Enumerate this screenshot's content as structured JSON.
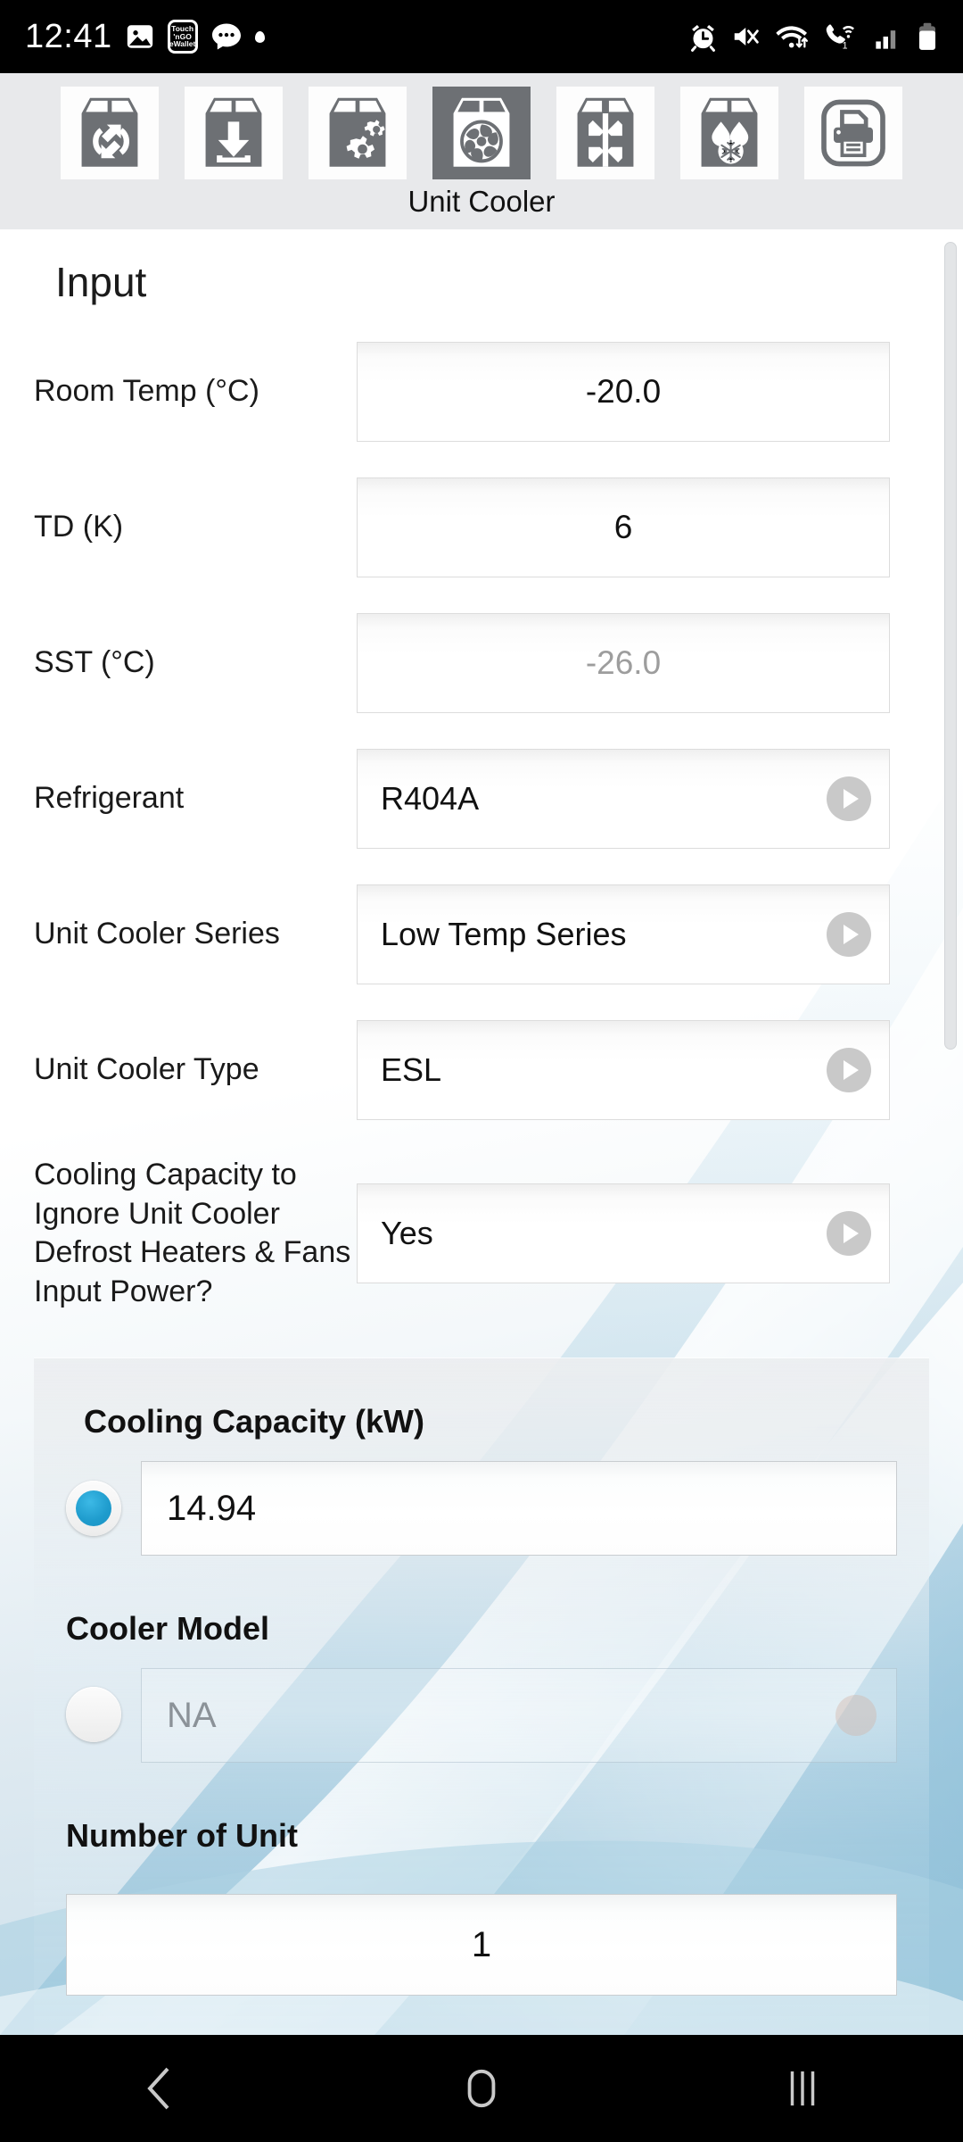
{
  "status_bar": {
    "time": "12:41",
    "left_icons": [
      "photo-icon",
      "touch-n-go-wallet-icon",
      "messages-icon",
      "notification-dot-icon"
    ],
    "tng_line1": "Touch",
    "tng_line2": "'nGO",
    "tng_line3": "eWallet",
    "right_icons": [
      "alarm-icon",
      "mute-vibrate-icon",
      "wifi-data-icon",
      "wifi-calling-icon",
      "signal-bars-icon",
      "battery-icon"
    ],
    "wifi_calling_badge": "1"
  },
  "toolbar": {
    "title": "Unit Cooler",
    "buttons": [
      {
        "name": "box-refresh",
        "selected": false
      },
      {
        "name": "box-download",
        "selected": false
      },
      {
        "name": "box-gears",
        "selected": false
      },
      {
        "name": "box-fan",
        "selected": true
      },
      {
        "name": "box-compress",
        "selected": false
      },
      {
        "name": "box-defrost-droplets",
        "selected": false
      },
      {
        "name": "printer",
        "selected": false
      }
    ]
  },
  "input_section": {
    "title": "Input",
    "fields": [
      {
        "label": "Room Temp (°C)",
        "value": "-20.0",
        "type": "number",
        "readonly": false,
        "align": "center"
      },
      {
        "label": "TD (K)",
        "value": "6",
        "type": "number",
        "readonly": false,
        "align": "center"
      },
      {
        "label": "SST (°C)",
        "value": "-26.0",
        "type": "number",
        "readonly": true,
        "align": "center"
      },
      {
        "label": "Refrigerant",
        "value": "R404A",
        "type": "dropdown",
        "readonly": false,
        "align": "left"
      },
      {
        "label": "Unit Cooler Series",
        "value": "Low Temp Series",
        "type": "dropdown",
        "readonly": false,
        "align": "left"
      },
      {
        "label": "Unit Cooler Type",
        "value": "ESL",
        "type": "dropdown",
        "readonly": false,
        "align": "left"
      },
      {
        "label": "Cooling Capacity to Ignore Unit Cooler Defrost Heaters & Fans Input Power?",
        "value": "Yes",
        "type": "dropdown",
        "readonly": false,
        "align": "left"
      }
    ]
  },
  "selection_card": {
    "cooling_capacity": {
      "heading": "Cooling Capacity (kW)",
      "value": "14.94",
      "radio_selected": true
    },
    "cooler_model": {
      "heading": "Cooler Model",
      "value": "NA",
      "radio_selected": false
    },
    "number_of_unit": {
      "heading": "Number of Unit",
      "value": "1"
    }
  },
  "nav_bar": {
    "buttons": [
      "back-icon",
      "home-icon",
      "recents-icon"
    ]
  },
  "colors": {
    "accent": "#1f9ccd",
    "toolbar_bg": "#e8e9eb",
    "selected_btn": "#6d7074",
    "icon_gray": "#6d7074"
  }
}
